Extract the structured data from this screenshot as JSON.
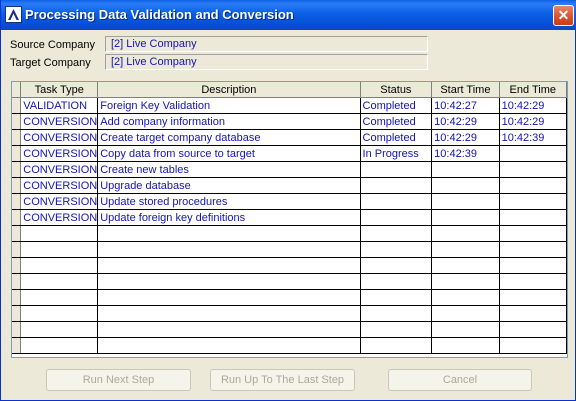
{
  "window": {
    "title": "Processing Data Validation and Conversion",
    "close_glyph": "✕"
  },
  "form": {
    "source_label": "Source Company",
    "source_value": "[2] Live Company",
    "target_label": "Target Company",
    "target_value": "[2] Live Company"
  },
  "grid": {
    "columns": [
      "Task Type",
      "Description",
      "Status",
      "Start Time",
      "End Time"
    ],
    "rows": [
      [
        "VALIDATION",
        "Foreign Key Validation",
        "Completed",
        "10:42:27",
        "10:42:29"
      ],
      [
        "CONVERSION",
        "Add company information",
        "Completed",
        "10:42:29",
        "10:42:29"
      ],
      [
        "CONVERSION",
        "Create target company database",
        "Completed",
        "10:42:29",
        "10:42:39"
      ],
      [
        "CONVERSION",
        "Copy data from source to target",
        "In Progress",
        "10:42:39",
        ""
      ],
      [
        "CONVERSION",
        "Create new tables",
        "",
        "",
        ""
      ],
      [
        "CONVERSION",
        "Upgrade database",
        "",
        "",
        ""
      ],
      [
        "CONVERSION",
        "Update stored procedures",
        "",
        "",
        ""
      ],
      [
        "CONVERSION",
        "Update foreign key definitions",
        "",
        "",
        ""
      ],
      [
        "",
        "",
        "",
        "",
        ""
      ],
      [
        "",
        "",
        "",
        "",
        ""
      ],
      [
        "",
        "",
        "",
        "",
        ""
      ],
      [
        "",
        "",
        "",
        "",
        ""
      ],
      [
        "",
        "",
        "",
        "",
        ""
      ],
      [
        "",
        "",
        "",
        "",
        ""
      ],
      [
        "",
        "",
        "",
        "",
        ""
      ],
      [
        "",
        "",
        "",
        "",
        ""
      ]
    ]
  },
  "buttons": {
    "run_next": "Run Next Step",
    "run_up_to_last": "Run Up To The Last Step",
    "cancel": "Cancel"
  },
  "colors": {
    "title_bar": "#0a5fe6",
    "data_text": "#1414b4",
    "dialog_bg": "#ece9d8"
  }
}
